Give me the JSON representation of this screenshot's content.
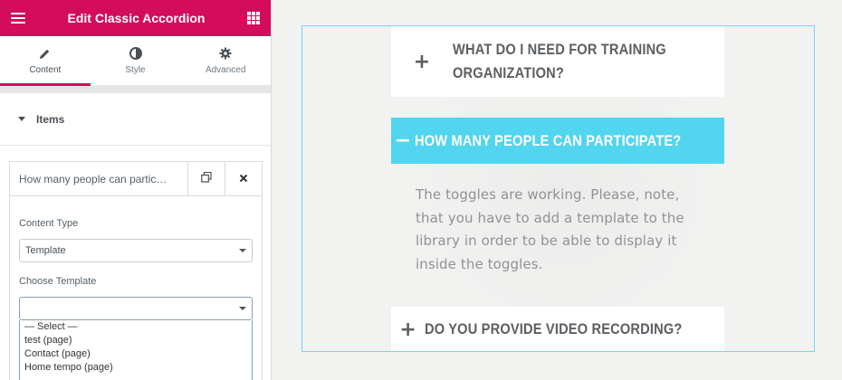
{
  "panel": {
    "title": "Edit Classic Accordion",
    "tabs": [
      {
        "label": "Content",
        "icon": "pencil-icon"
      },
      {
        "label": "Style",
        "icon": "contrast-icon"
      },
      {
        "label": "Advanced",
        "icon": "gear-icon"
      }
    ],
    "section_title": "Items",
    "item": {
      "title": "How many people can partic…",
      "content_type_label": "Content Type",
      "content_type_value": "Template",
      "choose_template_label": "Choose Template",
      "choose_template_value": "",
      "template_options": [
        "— Select —",
        "test (page)",
        "Contact (page)",
        "Home tempo (page)"
      ]
    }
  },
  "accordion": {
    "items": [
      {
        "sign": "+",
        "title_line1": "What do I need for training",
        "title_line2": "organization?"
      },
      {
        "sign": "−",
        "title_line1": "How many people can participate?"
      },
      {
        "sign": "+",
        "title_line1": "Do you provide video recording?"
      }
    ],
    "answer_lines": [
      "The toggles are working. Please, note,",
      "that you have to add a template to the",
      "library in order to be able to display it",
      "inside the toggles."
    ]
  },
  "colors": {
    "brand": "#d30c5c",
    "accent": "#52d5ef",
    "border_highlight": "#71d7f7"
  }
}
